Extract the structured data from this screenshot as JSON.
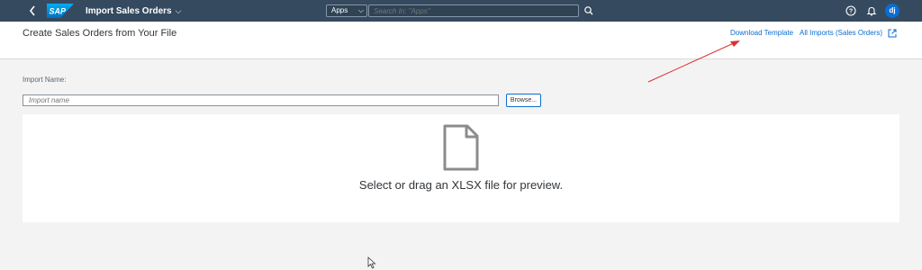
{
  "shell": {
    "logo_text": "SAP",
    "app_title": "Import Sales Orders",
    "apps_filter": "Apps",
    "search_placeholder": "Search In: \"Apps\"",
    "avatar_initials": "dj",
    "brand_color": "#354a5f",
    "accent_color": "#0a6ed1"
  },
  "header": {
    "page_title": "Create Sales Orders from Your File",
    "download_template_label": "Download Template",
    "all_imports_label": "All Imports (Sales Orders)"
  },
  "form": {
    "import_name_label": "Import Name:",
    "import_name_placeholder": "Import name",
    "browse_label": "Browse..."
  },
  "dropzone": {
    "message": "Select or drag an XLSX file for preview."
  },
  "annotation": {
    "arrow_color": "#d9302f"
  }
}
